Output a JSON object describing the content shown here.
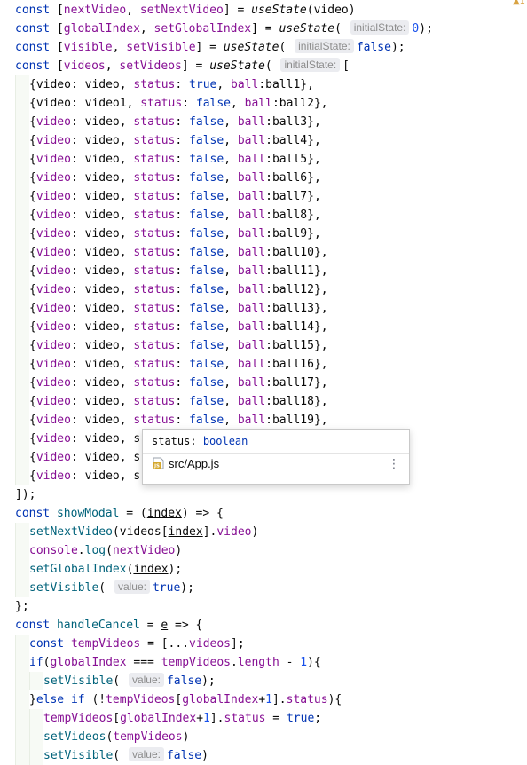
{
  "editor": {
    "lines": [
      [
        [
          "kw",
          "const "
        ],
        [
          "p",
          "["
        ],
        [
          "var",
          "nextVideo"
        ],
        [
          "p",
          ", "
        ],
        [
          "var",
          "setNextVideo"
        ],
        [
          "p",
          "] = "
        ],
        [
          "call",
          "useState"
        ],
        [
          "p",
          "(video)"
        ]
      ],
      [
        [
          "kw",
          "const "
        ],
        [
          "p",
          "["
        ],
        [
          "var",
          "globalIndex"
        ],
        [
          "p",
          ", "
        ],
        [
          "var",
          "setGlobalIndex"
        ],
        [
          "p",
          "] = "
        ],
        [
          "call",
          "useState"
        ],
        [
          "p",
          "( "
        ],
        [
          "hint",
          "initialState:"
        ],
        [
          "num",
          "0"
        ],
        [
          "p",
          ");"
        ]
      ],
      [
        [
          "kw",
          "const "
        ],
        [
          "p",
          "["
        ],
        [
          "var",
          "visible"
        ],
        [
          "p",
          ", "
        ],
        [
          "var",
          "setVisible"
        ],
        [
          "p",
          "] = "
        ],
        [
          "call",
          "useState"
        ],
        [
          "p",
          "( "
        ],
        [
          "hint",
          "initialState:"
        ],
        [
          "kw",
          "false"
        ],
        [
          "p",
          ");"
        ]
      ],
      [
        [
          "kw",
          "const "
        ],
        [
          "p",
          "["
        ],
        [
          "var",
          "videos"
        ],
        [
          "p",
          ", "
        ],
        [
          "var",
          "setVideos"
        ],
        [
          "p",
          "] = "
        ],
        [
          "call",
          "useState"
        ],
        [
          "p",
          "( "
        ],
        [
          "hint",
          "initialState:"
        ],
        [
          "p",
          "["
        ]
      ],
      [
        [
          "p",
          "{"
        ],
        [
          "id",
          "video"
        ],
        [
          "p",
          ": video, "
        ],
        [
          "var",
          "status"
        ],
        [
          "p",
          ": "
        ],
        [
          "kw",
          "true"
        ],
        [
          "p",
          ", "
        ],
        [
          "var",
          "ball"
        ],
        [
          "p",
          ":ball1},"
        ]
      ],
      [
        [
          "p",
          "{"
        ],
        [
          "id",
          "video"
        ],
        [
          "p",
          ": video1, "
        ],
        [
          "var",
          "status"
        ],
        [
          "p",
          ": "
        ],
        [
          "kw",
          "false"
        ],
        [
          "p",
          ", "
        ],
        [
          "var",
          "ball"
        ],
        [
          "p",
          ":ball2},"
        ]
      ],
      [
        [
          "p",
          "{"
        ],
        [
          "var",
          "video"
        ],
        [
          "p",
          ": video, "
        ],
        [
          "var",
          "status"
        ],
        [
          "p",
          ": "
        ],
        [
          "kw",
          "false"
        ],
        [
          "p",
          ", "
        ],
        [
          "var",
          "ball"
        ],
        [
          "p",
          ":ball3},"
        ]
      ],
      [
        [
          "p",
          "{"
        ],
        [
          "var",
          "video"
        ],
        [
          "p",
          ": video, "
        ],
        [
          "var",
          "status"
        ],
        [
          "p",
          ": "
        ],
        [
          "kw",
          "false"
        ],
        [
          "p",
          ", "
        ],
        [
          "var",
          "ball"
        ],
        [
          "p",
          ":ball4},"
        ]
      ],
      [
        [
          "p",
          "{"
        ],
        [
          "var",
          "video"
        ],
        [
          "p",
          ": video, "
        ],
        [
          "var",
          "status"
        ],
        [
          "p",
          ": "
        ],
        [
          "kw",
          "false"
        ],
        [
          "p",
          ", "
        ],
        [
          "var",
          "ball"
        ],
        [
          "p",
          ":ball5},"
        ]
      ],
      [
        [
          "p",
          "{"
        ],
        [
          "var",
          "video"
        ],
        [
          "p",
          ": video, "
        ],
        [
          "var",
          "status"
        ],
        [
          "p",
          ": "
        ],
        [
          "kw",
          "false"
        ],
        [
          "p",
          ", "
        ],
        [
          "var",
          "ball"
        ],
        [
          "p",
          ":ball6},"
        ]
      ],
      [
        [
          "p",
          "{"
        ],
        [
          "var",
          "video"
        ],
        [
          "p",
          ": video, "
        ],
        [
          "var",
          "status"
        ],
        [
          "p",
          ": "
        ],
        [
          "kw",
          "false"
        ],
        [
          "p",
          ", "
        ],
        [
          "var",
          "ball"
        ],
        [
          "p",
          ":ball7},"
        ]
      ],
      [
        [
          "p",
          "{"
        ],
        [
          "var",
          "video"
        ],
        [
          "p",
          ": video, "
        ],
        [
          "var",
          "status"
        ],
        [
          "p",
          ": "
        ],
        [
          "kw",
          "false"
        ],
        [
          "p",
          ", "
        ],
        [
          "var",
          "ball"
        ],
        [
          "p",
          ":ball8},"
        ]
      ],
      [
        [
          "p",
          "{"
        ],
        [
          "var",
          "video"
        ],
        [
          "p",
          ": video, "
        ],
        [
          "var",
          "status"
        ],
        [
          "p",
          ": "
        ],
        [
          "kw",
          "false"
        ],
        [
          "p",
          ", "
        ],
        [
          "var",
          "ball"
        ],
        [
          "p",
          ":ball9},"
        ]
      ],
      [
        [
          "p",
          "{"
        ],
        [
          "var",
          "video"
        ],
        [
          "p",
          ": video, "
        ],
        [
          "var",
          "status"
        ],
        [
          "p",
          ": "
        ],
        [
          "kw",
          "false"
        ],
        [
          "p",
          ", "
        ],
        [
          "var",
          "ball"
        ],
        [
          "p",
          ":ball10},"
        ]
      ],
      [
        [
          "p",
          "{"
        ],
        [
          "var",
          "video"
        ],
        [
          "p",
          ": video, "
        ],
        [
          "var",
          "status"
        ],
        [
          "p",
          ": "
        ],
        [
          "kw",
          "false"
        ],
        [
          "p",
          ", "
        ],
        [
          "var",
          "ball"
        ],
        [
          "p",
          ":ball11},"
        ]
      ],
      [
        [
          "p",
          "{"
        ],
        [
          "var",
          "video"
        ],
        [
          "p",
          ": video, "
        ],
        [
          "var",
          "status"
        ],
        [
          "p",
          ": "
        ],
        [
          "kw",
          "false"
        ],
        [
          "p",
          ", "
        ],
        [
          "var",
          "ball"
        ],
        [
          "p",
          ":ball12},"
        ]
      ],
      [
        [
          "p",
          "{"
        ],
        [
          "var",
          "video"
        ],
        [
          "p",
          ": video, "
        ],
        [
          "var",
          "status"
        ],
        [
          "p",
          ": "
        ],
        [
          "kw",
          "false"
        ],
        [
          "p",
          ", "
        ],
        [
          "var",
          "ball"
        ],
        [
          "p",
          ":ball13},"
        ]
      ],
      [
        [
          "p",
          "{"
        ],
        [
          "var",
          "video"
        ],
        [
          "p",
          ": video, "
        ],
        [
          "var",
          "status"
        ],
        [
          "p",
          ": "
        ],
        [
          "kw",
          "false"
        ],
        [
          "p",
          ", "
        ],
        [
          "var",
          "ball"
        ],
        [
          "p",
          ":ball14},"
        ]
      ],
      [
        [
          "p",
          "{"
        ],
        [
          "var",
          "video"
        ],
        [
          "p",
          ": video, "
        ],
        [
          "var",
          "status"
        ],
        [
          "p",
          ": "
        ],
        [
          "kw",
          "false"
        ],
        [
          "p",
          ", "
        ],
        [
          "var",
          "ball"
        ],
        [
          "p",
          ":ball15},"
        ]
      ],
      [
        [
          "p",
          "{"
        ],
        [
          "var",
          "video"
        ],
        [
          "p",
          ": video, "
        ],
        [
          "var",
          "status"
        ],
        [
          "p",
          ": "
        ],
        [
          "kw",
          "false"
        ],
        [
          "p",
          ", "
        ],
        [
          "var",
          "ball"
        ],
        [
          "p",
          ":ball16},"
        ]
      ],
      [
        [
          "p",
          "{"
        ],
        [
          "var",
          "video"
        ],
        [
          "p",
          ": video, "
        ],
        [
          "var",
          "status"
        ],
        [
          "p",
          ": "
        ],
        [
          "kw",
          "false"
        ],
        [
          "p",
          ", "
        ],
        [
          "var",
          "ball"
        ],
        [
          "p",
          ":ball17},"
        ]
      ],
      [
        [
          "p",
          "{"
        ],
        [
          "var",
          "video"
        ],
        [
          "p",
          ": video, "
        ],
        [
          "var",
          "status"
        ],
        [
          "p",
          ": "
        ],
        [
          "kw",
          "false"
        ],
        [
          "p",
          ", "
        ],
        [
          "var",
          "ball"
        ],
        [
          "p",
          ":ball18},"
        ]
      ],
      [
        [
          "p",
          "{"
        ],
        [
          "var",
          "video"
        ],
        [
          "p",
          ": video, "
        ],
        [
          "var",
          "status"
        ],
        [
          "p",
          ": "
        ],
        [
          "kw",
          "false"
        ],
        [
          "p",
          ", "
        ],
        [
          "var",
          "ball"
        ],
        [
          "p",
          ":ball19},"
        ]
      ],
      [
        [
          "p",
          "{"
        ],
        [
          "var",
          "video"
        ],
        [
          "p",
          ": video, s"
        ]
      ],
      [
        [
          "p",
          "{"
        ],
        [
          "var",
          "video"
        ],
        [
          "p",
          ": video, s"
        ]
      ],
      [
        [
          "p",
          "{"
        ],
        [
          "var",
          "video"
        ],
        [
          "p",
          ": video, s"
        ]
      ],
      [
        [
          "p",
          "]);"
        ]
      ],
      [
        [
          "kw",
          "const "
        ],
        [
          "fn",
          "showModal"
        ],
        [
          "p",
          " = ("
        ],
        [
          "param",
          "index"
        ],
        [
          "p",
          ") => {"
        ]
      ],
      [
        [
          "fn",
          "setNextVideo"
        ],
        [
          "p",
          "(videos["
        ],
        [
          "param",
          "index"
        ],
        [
          "p",
          "]."
        ],
        [
          "var",
          "video"
        ],
        [
          "p",
          ")"
        ]
      ],
      [
        [
          "var",
          "console"
        ],
        [
          "p",
          "."
        ],
        [
          "fn",
          "log"
        ],
        [
          "p",
          "("
        ],
        [
          "var",
          "nextVideo"
        ],
        [
          "p",
          ")"
        ]
      ],
      [
        [
          "fn",
          "setGlobalIndex"
        ],
        [
          "p",
          "("
        ],
        [
          "param",
          "index"
        ],
        [
          "p",
          ");"
        ]
      ],
      [
        [
          "fn",
          "setVisible"
        ],
        [
          "p",
          "( "
        ],
        [
          "hint",
          "value:"
        ],
        [
          "kw",
          "true"
        ],
        [
          "p",
          ");"
        ]
      ],
      [
        [
          "p",
          "};"
        ]
      ],
      [
        [
          "kw",
          "const "
        ],
        [
          "fn",
          "handleCancel"
        ],
        [
          "p",
          " = "
        ],
        [
          "param",
          "e"
        ],
        [
          "p",
          " => {"
        ]
      ],
      [
        [
          "kw",
          "const "
        ],
        [
          "var",
          "tempVideos"
        ],
        [
          "p",
          " = [..."
        ],
        [
          "var",
          "videos"
        ],
        [
          "p",
          "];"
        ]
      ],
      [
        [
          "kw",
          "if"
        ],
        [
          "p",
          "("
        ],
        [
          "var",
          "globalIndex"
        ],
        [
          "p",
          " === "
        ],
        [
          "var",
          "tempVideos"
        ],
        [
          "p",
          "."
        ],
        [
          "var",
          "length"
        ],
        [
          "p",
          " - "
        ],
        [
          "num",
          "1"
        ],
        [
          "p",
          "){"
        ]
      ],
      [
        [
          "fn",
          "setVisible"
        ],
        [
          "p",
          "( "
        ],
        [
          "hint",
          "value:"
        ],
        [
          "kw",
          "false"
        ],
        [
          "p",
          ");"
        ]
      ],
      [
        [
          "p",
          "}"
        ],
        [
          "kw",
          "else if "
        ],
        [
          "p",
          "(!"
        ],
        [
          "var",
          "tempVideos"
        ],
        [
          "p",
          "["
        ],
        [
          "var",
          "globalIndex"
        ],
        [
          "p",
          "+"
        ],
        [
          "num",
          "1"
        ],
        [
          "p",
          "]."
        ],
        [
          "var",
          "status"
        ],
        [
          "p",
          "){"
        ]
      ],
      [
        [
          "var",
          "tempVideos"
        ],
        [
          "p",
          "["
        ],
        [
          "var",
          "globalIndex"
        ],
        [
          "p",
          "+"
        ],
        [
          "num",
          "1"
        ],
        [
          "p",
          "]."
        ],
        [
          "var",
          "status"
        ],
        [
          "p",
          " = "
        ],
        [
          "kw",
          "true"
        ],
        [
          "p",
          ";"
        ]
      ],
      [
        [
          "fn",
          "setVideos"
        ],
        [
          "p",
          "("
        ],
        [
          "var",
          "tempVideos"
        ],
        [
          "p",
          ")"
        ]
      ],
      [
        [
          "fn",
          "setVisible"
        ],
        [
          "p",
          "( "
        ],
        [
          "hint",
          "value:"
        ],
        [
          "kw",
          "false"
        ],
        [
          "p",
          ")"
        ]
      ]
    ]
  },
  "popup": {
    "signature_name": "status",
    "signature_sep": ": ",
    "signature_type": "boolean",
    "file": "src/App.js",
    "more_icon": "vertical-ellipsis-icon"
  },
  "gutter": {
    "warning_icon": "warning-icon",
    "warning_glyph": "▲1"
  }
}
